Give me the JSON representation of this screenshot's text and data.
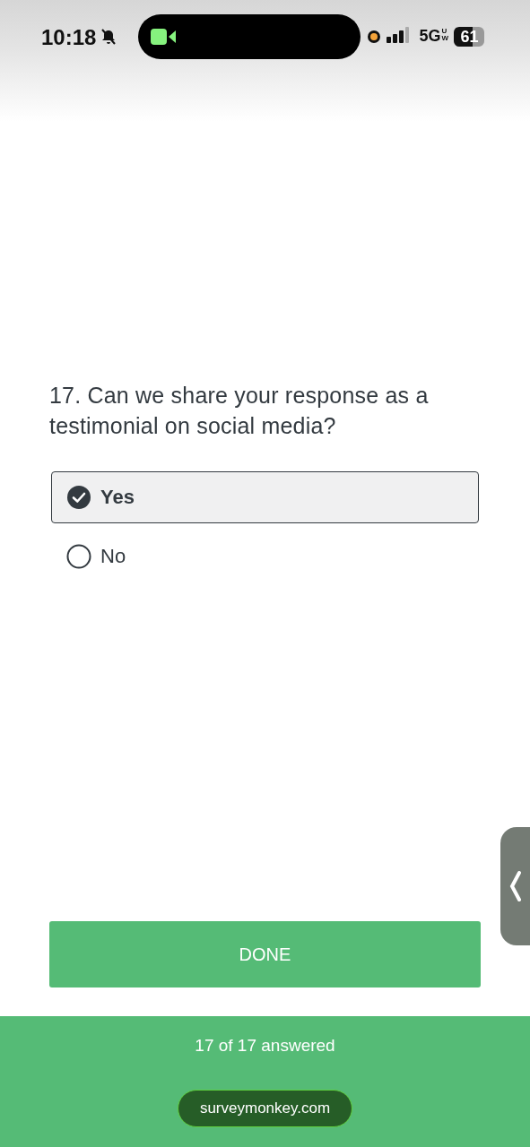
{
  "status_bar": {
    "time": "10:18",
    "network": "5G",
    "network_sub": "UW",
    "battery": "61"
  },
  "question": {
    "text": "17. Can we share your response as a testimonial on social media?",
    "options": [
      {
        "label": "Yes",
        "selected": true
      },
      {
        "label": "No",
        "selected": false
      }
    ]
  },
  "done_button": "DONE",
  "footer": {
    "progress": "17 of 17 answered",
    "link": "surveymonkey.com"
  }
}
